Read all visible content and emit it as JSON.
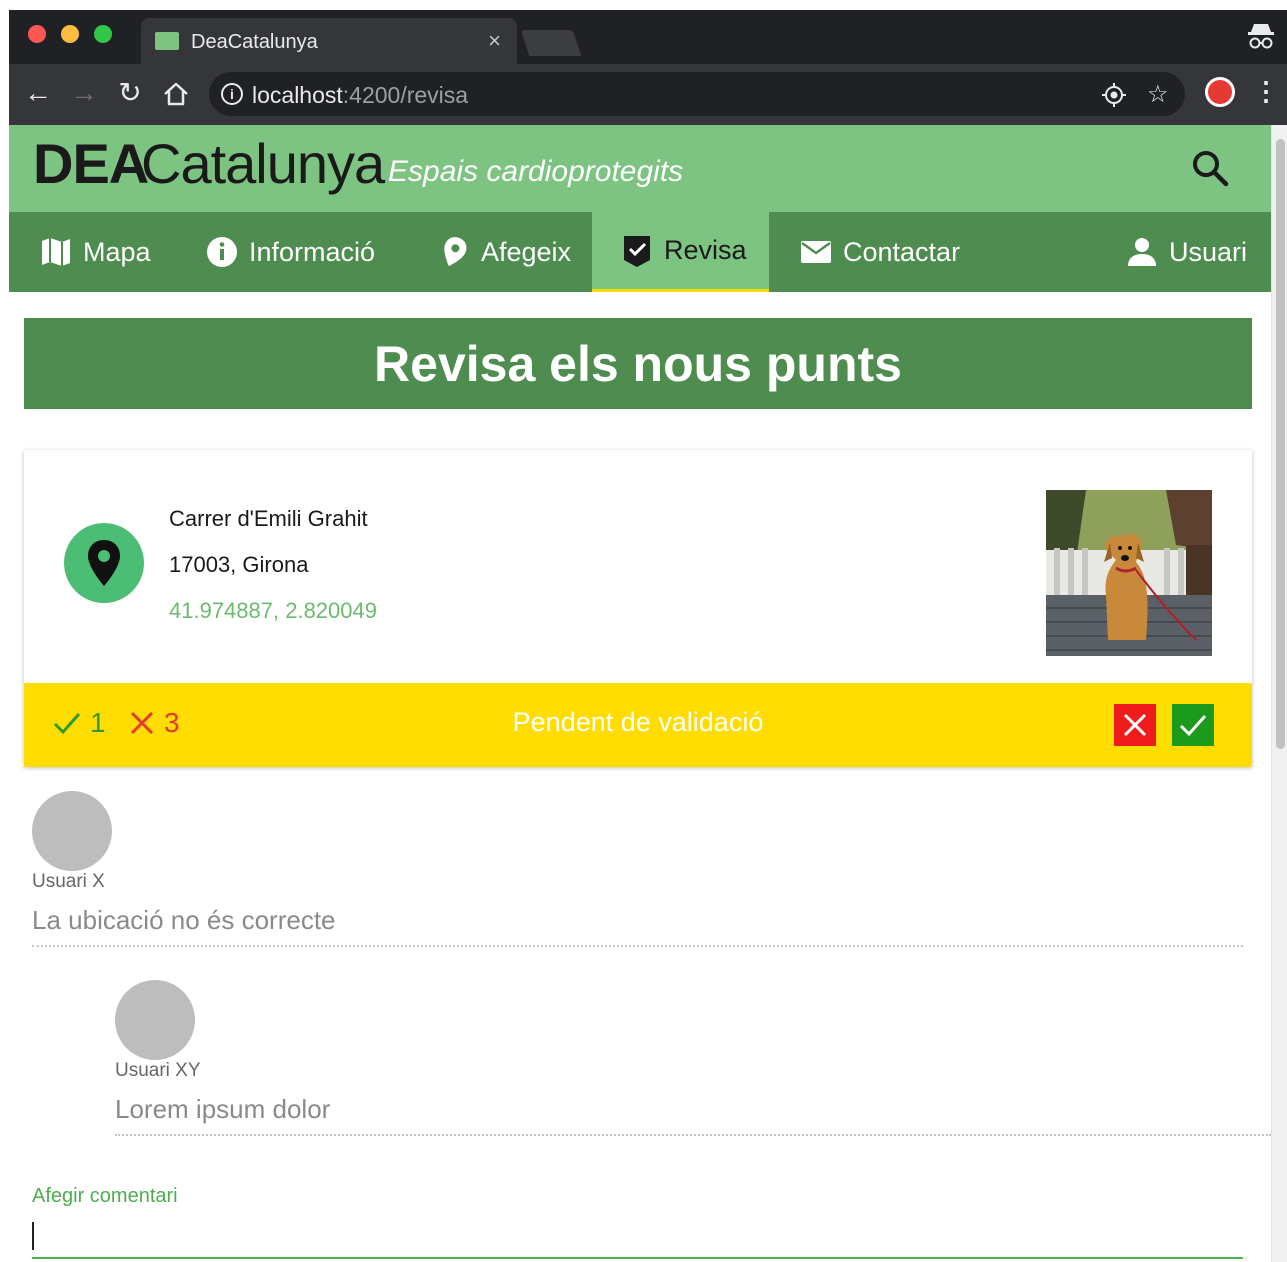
{
  "browser": {
    "tab_title": "DeaCatalunya",
    "tab_close": "×",
    "url_host": "localhost",
    "url_rest": ":4200/revisa",
    "info_glyph": "i"
  },
  "header": {
    "logo_bold": "DEA",
    "logo_light": "Catalunya",
    "tagline": "Espais cardioprotegits"
  },
  "nav": {
    "items": [
      {
        "label": "Mapa",
        "icon": "map-icon"
      },
      {
        "label": "Informació",
        "icon": "info-icon"
      },
      {
        "label": "Afegeix",
        "icon": "location-pin-icon"
      },
      {
        "label": "Revisa",
        "icon": "check-badge-icon",
        "active": true
      },
      {
        "label": "Contactar",
        "icon": "envelope-icon"
      },
      {
        "label": "Usuari",
        "icon": "user-icon"
      }
    ]
  },
  "banner": {
    "title": "Revisa els nous punts"
  },
  "card": {
    "address_line1": "Carrer d'Emili Grahit",
    "address_line2": "17003, Girona",
    "coords": "41.974887, 2.820049",
    "photo_icon": "dog-photo",
    "votes_ok": "1",
    "votes_ko": "3",
    "status": "Pendent de validació"
  },
  "comments": [
    {
      "user": "Usuari X",
      "text": "La ubicació no és correcte"
    },
    {
      "user": "Usuari XY",
      "text": "Lorem ipsum dolor"
    }
  ],
  "add_comment": {
    "label": "Afegir comentari",
    "value": ""
  },
  "colors": {
    "header_green": "#7dc381",
    "nav_green": "#4e8d4f",
    "status_yellow": "#ffdd00",
    "reject_red": "#f01c1c",
    "accept_green": "#1b9a1b"
  }
}
